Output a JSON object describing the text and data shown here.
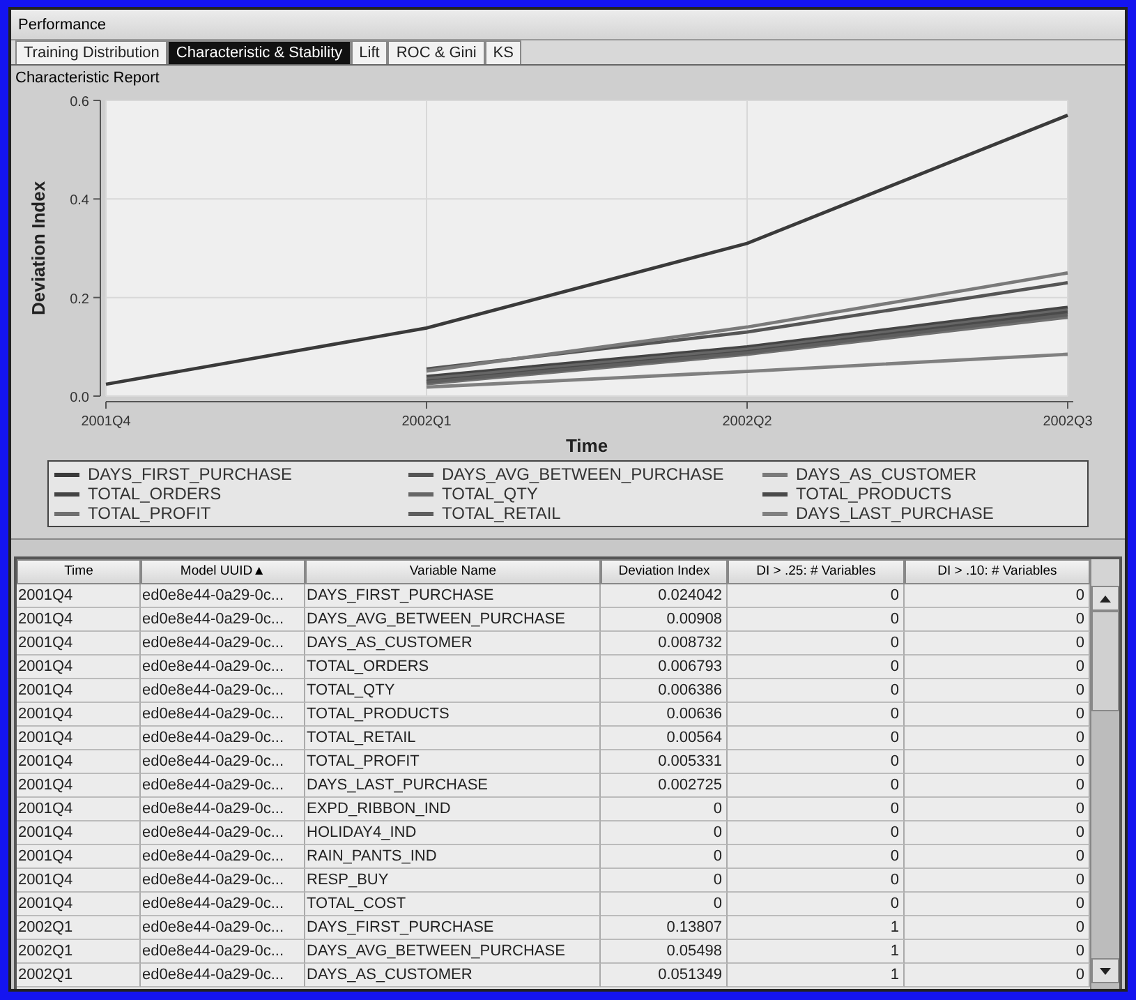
{
  "window": {
    "title": "Performance"
  },
  "tabs": [
    {
      "label": "Training Distribution",
      "selected": false
    },
    {
      "label": "Characteristic & Stability",
      "selected": true
    },
    {
      "label": "Lift",
      "selected": false
    },
    {
      "label": "ROC & Gini",
      "selected": false
    },
    {
      "label": "KS",
      "selected": false
    }
  ],
  "report": {
    "title": "Characteristic Report",
    "chart_data": {
      "type": "line",
      "grid": true,
      "xlabel": "Time",
      "ylabel": "Deviation Index",
      "categories": [
        "2001Q4",
        "2002Q1",
        "2002Q2",
        "2002Q3"
      ],
      "ylim": [
        0,
        0.6
      ],
      "yticks": [
        {
          "value": 0,
          "label": "0.0"
        },
        {
          "value": 0.2,
          "label": "0.2"
        },
        {
          "value": 0.4,
          "label": "0.4"
        },
        {
          "value": 0.6,
          "label": "0.6"
        }
      ],
      "series": [
        {
          "name": "DAYS_FIRST_PURCHASE",
          "color": "#3a3a3a",
          "values": [
            0.024,
            0.138,
            0.31,
            0.57
          ]
        },
        {
          "name": "DAYS_AVG_BETWEEN_PURCHASE",
          "color": "#555555",
          "values": [
            null,
            0.055,
            0.13,
            0.23
          ]
        },
        {
          "name": "DAYS_AS_CUSTOMER",
          "color": "#7a7a7a",
          "values": [
            null,
            0.051,
            0.14,
            0.25
          ]
        },
        {
          "name": "TOTAL_ORDERS",
          "color": "#444444",
          "values": [
            null,
            0.04,
            0.1,
            0.18
          ]
        },
        {
          "name": "TOTAL_QTY",
          "color": "#666666",
          "values": [
            null,
            0.035,
            0.095,
            0.175
          ]
        },
        {
          "name": "TOTAL_PRODUCTS",
          "color": "#4a4a4a",
          "values": [
            null,
            0.03,
            0.09,
            0.17
          ]
        },
        {
          "name": "TOTAL_PROFIT",
          "color": "#707070",
          "values": [
            null,
            0.025,
            0.085,
            0.16
          ]
        },
        {
          "name": "TOTAL_RETAIL",
          "color": "#5e5e5e",
          "values": [
            null,
            0.028,
            0.088,
            0.165
          ]
        },
        {
          "name": "DAYS_LAST_PURCHASE",
          "color": "#808080",
          "values": [
            null,
            0.018,
            0.05,
            0.085
          ]
        }
      ]
    }
  },
  "table": {
    "columns": [
      {
        "label": "Time"
      },
      {
        "label": "Model UUID",
        "sort_indicator": "▲"
      },
      {
        "label": "Variable Name"
      },
      {
        "label": "Deviation Index"
      },
      {
        "label": "DI > .25: # Variables"
      },
      {
        "label": "DI > .10: # Variables"
      }
    ],
    "rows": [
      [
        "2001Q4",
        "ed0e8e44-0a29-0c...",
        "DAYS_FIRST_PURCHASE",
        "0.024042",
        "0",
        "0"
      ],
      [
        "2001Q4",
        "ed0e8e44-0a29-0c...",
        "DAYS_AVG_BETWEEN_PURCHASE",
        "0.00908",
        "0",
        "0"
      ],
      [
        "2001Q4",
        "ed0e8e44-0a29-0c...",
        "DAYS_AS_CUSTOMER",
        "0.008732",
        "0",
        "0"
      ],
      [
        "2001Q4",
        "ed0e8e44-0a29-0c...",
        "TOTAL_ORDERS",
        "0.006793",
        "0",
        "0"
      ],
      [
        "2001Q4",
        "ed0e8e44-0a29-0c...",
        "TOTAL_QTY",
        "0.006386",
        "0",
        "0"
      ],
      [
        "2001Q4",
        "ed0e8e44-0a29-0c...",
        "TOTAL_PRODUCTS",
        "0.00636",
        "0",
        "0"
      ],
      [
        "2001Q4",
        "ed0e8e44-0a29-0c...",
        "TOTAL_RETAIL",
        "0.00564",
        "0",
        "0"
      ],
      [
        "2001Q4",
        "ed0e8e44-0a29-0c...",
        "TOTAL_PROFIT",
        "0.005331",
        "0",
        "0"
      ],
      [
        "2001Q4",
        "ed0e8e44-0a29-0c...",
        "DAYS_LAST_PURCHASE",
        "0.002725",
        "0",
        "0"
      ],
      [
        "2001Q4",
        "ed0e8e44-0a29-0c...",
        "EXPD_RIBBON_IND",
        "0",
        "0",
        "0"
      ],
      [
        "2001Q4",
        "ed0e8e44-0a29-0c...",
        "HOLIDAY4_IND",
        "0",
        "0",
        "0"
      ],
      [
        "2001Q4",
        "ed0e8e44-0a29-0c...",
        "RAIN_PANTS_IND",
        "0",
        "0",
        "0"
      ],
      [
        "2001Q4",
        "ed0e8e44-0a29-0c...",
        "RESP_BUY",
        "0",
        "0",
        "0"
      ],
      [
        "2001Q4",
        "ed0e8e44-0a29-0c...",
        "TOTAL_COST",
        "0",
        "0",
        "0"
      ],
      [
        "2002Q1",
        "ed0e8e44-0a29-0c...",
        "DAYS_FIRST_PURCHASE",
        "0.13807",
        "1",
        "0"
      ],
      [
        "2002Q1",
        "ed0e8e44-0a29-0c...",
        "DAYS_AVG_BETWEEN_PURCHASE",
        "0.05498",
        "1",
        "0"
      ],
      [
        "2002Q1",
        "ed0e8e44-0a29-0c...",
        "DAYS_AS_CUSTOMER",
        "0.051349",
        "1",
        "0"
      ]
    ]
  }
}
